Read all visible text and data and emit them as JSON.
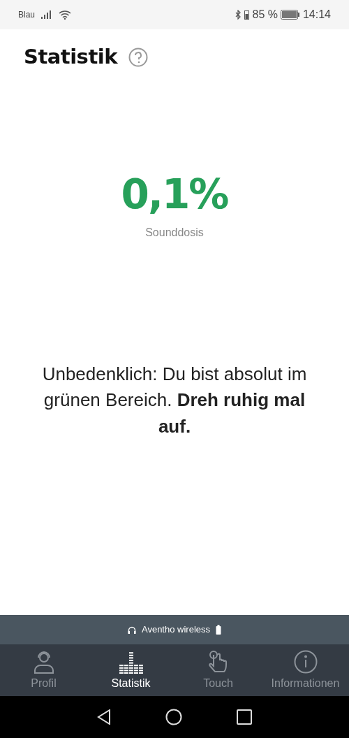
{
  "status_bar": {
    "carrier": "Blau",
    "battery": "85 %",
    "time": "14:14"
  },
  "header": {
    "title": "Statistik"
  },
  "dose": {
    "value": "0,1%",
    "label": "Sounddosis"
  },
  "message": "Unbedenklich: Du bist absolut im grünen Bereich. **Dreh ruhig mal auf.**",
  "device_bar": {
    "name": "Aventho wireless"
  },
  "tabs": [
    {
      "kind": "profile",
      "label": "Profil",
      "selected": false
    },
    {
      "kind": "stats",
      "label": "Statistik",
      "selected": true
    },
    {
      "kind": "touch",
      "label": "Touch",
      "selected": false
    },
    {
      "kind": "info",
      "label": "Informationen",
      "selected": false
    }
  ]
}
